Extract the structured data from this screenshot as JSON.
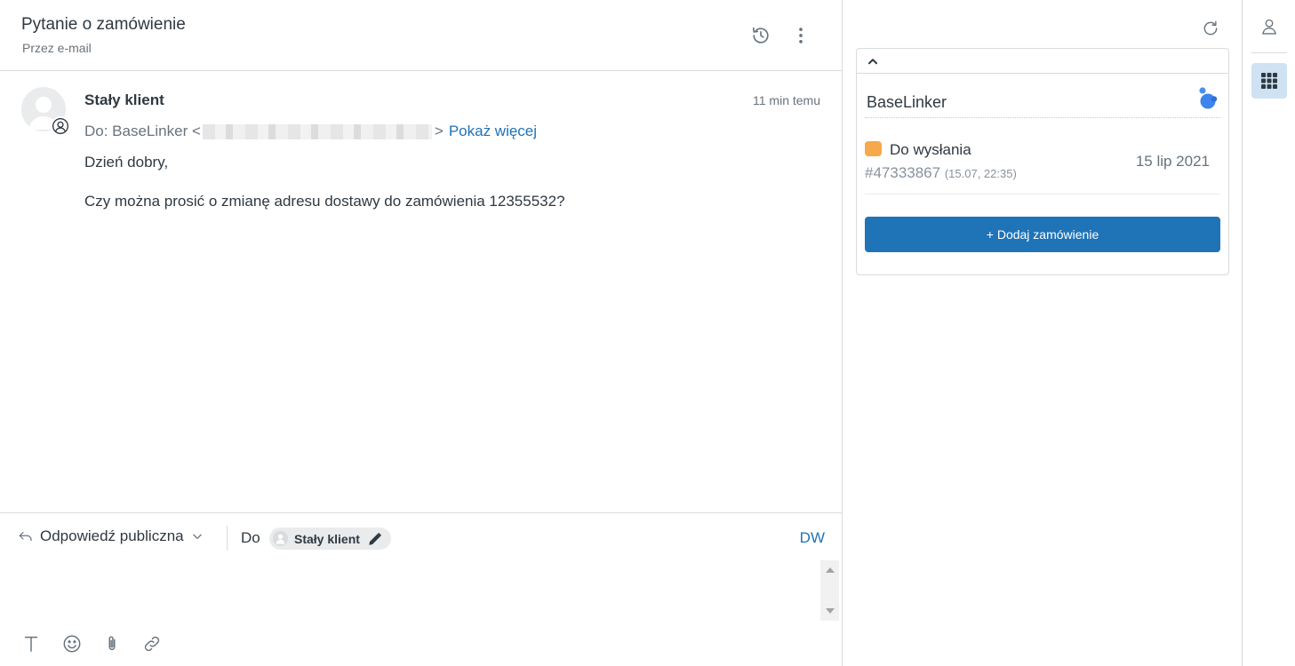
{
  "ticket": {
    "title": "Pytanie o zamówienie",
    "channel": "Przez e-mail"
  },
  "message": {
    "sender": "Stały klient",
    "time": "11 min temu",
    "to_prefix": "Do: BaseLinker <",
    "to_suffix": ">",
    "show_more": "Pokaż więcej",
    "greeting": "Dzień dobry,",
    "body": "Czy można prosić o zmianę adresu dostawy do zamówienia 12355532?"
  },
  "composer": {
    "reply_type": "Odpowiedź publiczna",
    "to_label": "Do",
    "recipient": "Stały klient",
    "cc_label": "DW"
  },
  "context_panel": {
    "app_name": "BaseLinker",
    "order": {
      "status": "Do wysłania",
      "status_color": "#f5a94a",
      "number": "#47333867",
      "timestamp": "(15.07, 22:35)",
      "date": "15 lip 2021"
    },
    "add_order_label": "+ Dodaj zamówienie"
  },
  "colors": {
    "accent": "#1f73b7",
    "selected_rail": "#cfe2f3"
  },
  "icons": {
    "header": [
      "history-icon",
      "more-vertical-icon"
    ],
    "composer_toolbar": [
      "text-format-icon",
      "emoji-icon",
      "attachment-icon",
      "link-icon"
    ],
    "rail": [
      "user-icon",
      "apps-grid-icon"
    ]
  }
}
